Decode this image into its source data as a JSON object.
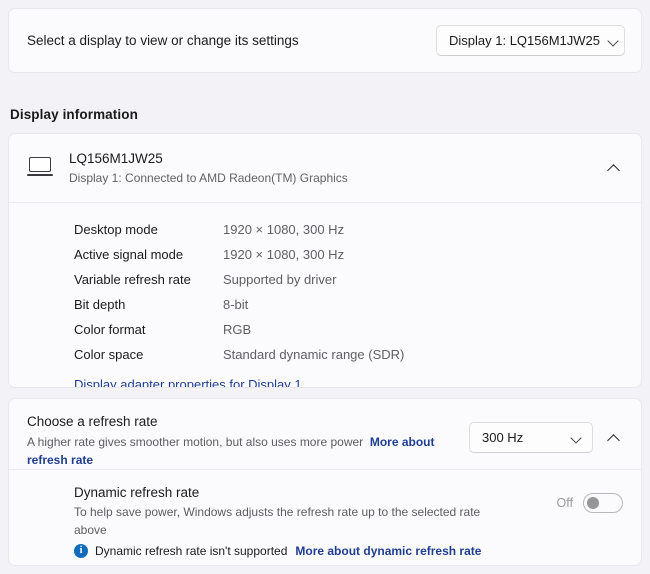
{
  "select_display": {
    "label": "Select a display to view or change its settings",
    "dropdown_value": "Display 1: LQ156M1JW25"
  },
  "section": {
    "heading": "Display information"
  },
  "display_info": {
    "title": "LQ156M1JW25",
    "subtitle": "Display 1: Connected to AMD Radeon(TM) Graphics",
    "rows": [
      {
        "key": "Desktop mode",
        "value": "1920 × 1080, 300 Hz"
      },
      {
        "key": "Active signal mode",
        "value": "1920 × 1080, 300 Hz"
      },
      {
        "key": "Variable refresh rate",
        "value": "Supported by driver"
      },
      {
        "key": "Bit depth",
        "value": "8-bit"
      },
      {
        "key": "Color format",
        "value": "RGB"
      },
      {
        "key": "Color space",
        "value": "Standard dynamic range (SDR)"
      }
    ],
    "adapter_link": "Display adapter properties for Display 1"
  },
  "refresh_rate": {
    "title": "Choose a refresh rate",
    "description": "A higher rate gives smoother motion, but also uses more power",
    "link": "More about refresh rate",
    "dropdown_value": "300 Hz"
  },
  "dynamic_refresh_rate": {
    "title": "Dynamic refresh rate",
    "description": "To help save power, Windows adjusts the refresh rate up to the selected rate above",
    "note": "Dynamic refresh rate isn't supported",
    "note_link": "More about dynamic refresh rate",
    "toggle_label": "Off"
  },
  "colors": {
    "page_background": "#f3f3f7",
    "card_background": "#fbfbfd",
    "link": "#1f3e91",
    "info_badge": "#0f6cbd",
    "secondary_text": "#606064"
  }
}
